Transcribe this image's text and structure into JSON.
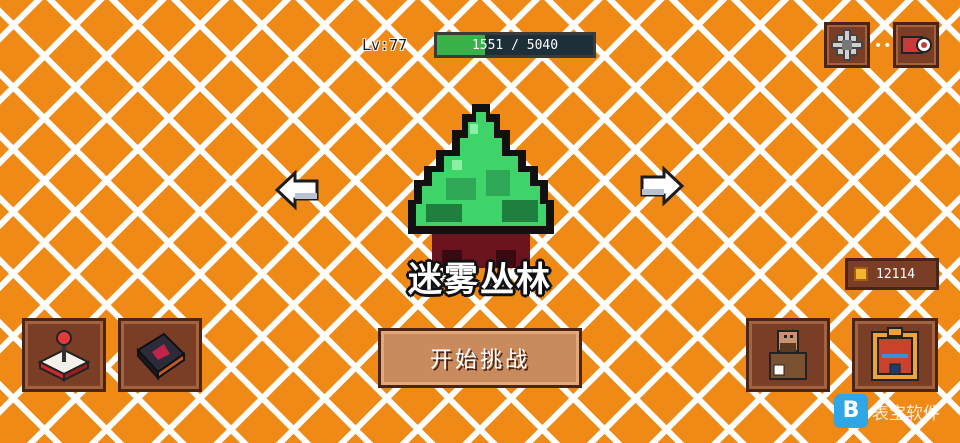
{
  "hud": {
    "level_label": "Lv:77",
    "xp_current": 1551,
    "xp_max": 5040,
    "xp_text": "1551 / 5040"
  },
  "stage": {
    "name": "迷雾丛林",
    "icon": "bush-icon"
  },
  "currency": {
    "icon": "coin-icon",
    "value": "12114"
  },
  "buttons": {
    "start_label": "开始挑战",
    "settings_icon": "gear-icon",
    "record_icon": "record-icon",
    "prev_icon": "arrow-left-icon",
    "next_icon": "arrow-right-icon",
    "joystick_icon": "joystick-icon",
    "book_icon": "spellbook-icon",
    "hero_icon": "hero-icon",
    "backpack_icon": "backpack-icon"
  },
  "watermark": {
    "badge": "B",
    "text": "表宝软件"
  },
  "colors": {
    "background": "#f08a16",
    "grid_lines": "#ffffff",
    "panel": "#7a3e27",
    "xp_fill": "#39b24a"
  }
}
